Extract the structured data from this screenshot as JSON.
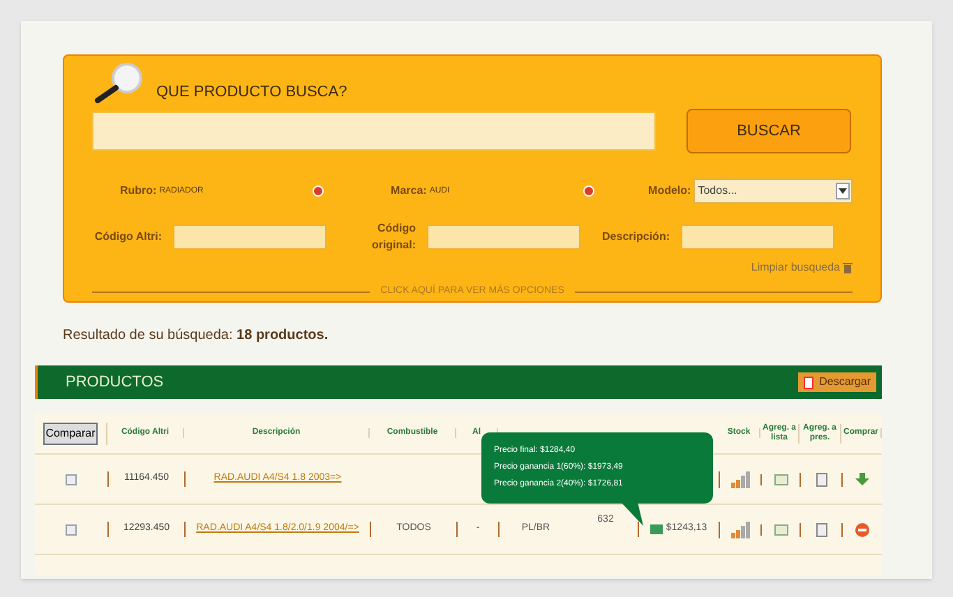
{
  "search": {
    "title": "QUE PRODUCTO BUSCA?",
    "button": "BUSCAR",
    "filters": [
      {
        "label": "Rubro:",
        "value": "RADIADOR"
      },
      {
        "label": "Marca:",
        "value": "AUDI"
      }
    ],
    "model": {
      "label": "Modelo:",
      "value": "Todos..."
    },
    "fields": [
      {
        "label": "Código Altri:"
      },
      {
        "label": "Código original:"
      },
      {
        "label": "Descripción:"
      }
    ],
    "clear": "Limpiar busqueda",
    "more": "CLICK AQUÍ PARA VER MÁS OPCIONES"
  },
  "result": {
    "text": "Resultado de su búsqueda: **18 productos.**"
  },
  "products": {
    "title": "PRODUCTOS",
    "download": "Descargar",
    "columns": [
      "Comparar",
      "Código Altri",
      "Descripción",
      "Combustible",
      "Al",
      "",
      "",
      "",
      "Stock",
      "Agreg. a lista",
      "Agreg. a pres.",
      "Comprar"
    ],
    "rows": [
      {
        "checked": false,
        "code": "11164.450",
        "description": "RAD.AUDI A4/S4 1.8 2003=>",
        "fuel": "",
        "column_5": "",
        "column_6": "",
        "column_7": "",
        "price": "",
        "can_buy": true
      },
      {
        "checked": false,
        "code": "12293.450",
        "description": "RAD.AUDI A4/S4 1.8/2.0/1.9 2004/=>",
        "fuel": "TODOS",
        "column_5": "-",
        "column_6": "PL/BR",
        "column_7": "632",
        "price": "$1243,13",
        "can_buy": false
      }
    ],
    "tooltip": [
      "Precio final: $1284,40",
      "Precio ganancia 1(60%): $1973,49",
      "Precio ganancia 2(40%): $1726,81"
    ]
  }
}
